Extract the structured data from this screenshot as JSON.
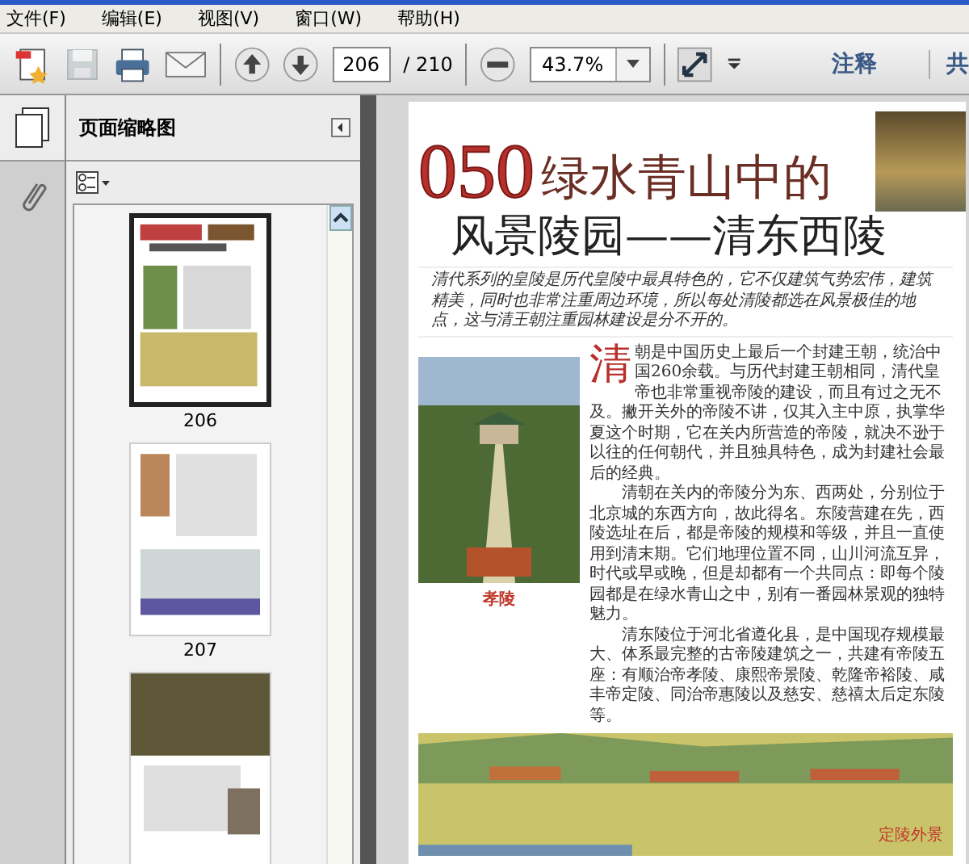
{
  "menu": [
    "文件(F)",
    "编辑(E)",
    "视图(V)",
    "窗口(W)",
    "帮助(H)"
  ],
  "toolbar": {
    "save_disabled": true,
    "page": "206",
    "page_total": "/ 210",
    "zoom": "43.7%",
    "comment": "注释",
    "share": "共"
  },
  "panel": {
    "title": "页面缩略图",
    "thumbnails": [
      {
        "kind": "title",
        "label": "206",
        "selected": true
      },
      {
        "kind": "arch",
        "label": "207",
        "selected": false
      },
      {
        "kind": "landscape",
        "selected": false
      }
    ]
  },
  "page": {
    "number": "050",
    "title": "绿水青山中的",
    "subtitle": "风景陵园——清东西陵",
    "intro": "清代系列的皇陵是历代皇陵中最具特色的，它不仅建筑气势宏伟，建筑精美，同时也非常注重周边环境，所以每处清陵都选在风景极佳的地点，这与清王朝注重园林建设是分不开的。",
    "drop_cap": "清",
    "paragraphs": [
      "朝是中国历史上最后一个封建王朝，统治中国260余载。与历代封建王朝相同，清代皇帝也非常重视帝陵的建设，而且有过之无不及。撇开关外的帝陵不讲，仅其入主中原，执掌华夏这个时期，它在关内所营造的帝陵，就决不逊于以往的任何朝代，并且独具特色，成为封建社会最后的经典。",
      "清朝在关内的帝陵分为东、西两处，分别位于北京城的东西方向，故此得名。东陵营建在先，西陵选址在后，都是帝陵的规模和等级，并且一直使用到清末期。它们地理位置不同，山川河流互异，时代或早或晚，但是却都有一个共同点：即每个陵园都是在绿水青山之中，别有一番园林景观的独特魅力。",
      "清东陵位于河北省遵化县，是中国现存规模最大、体系最完整的古帝陵建筑之一，共建有帝陵五座：有顺治帝孝陵、康熙帝景陵、乾隆帝裕陵、咸丰帝定陵、同治帝惠陵以及慈安、慈禧太后定东陵等。"
    ],
    "photo_caption": "孝陵",
    "landscape_caption": "定陵外景"
  }
}
